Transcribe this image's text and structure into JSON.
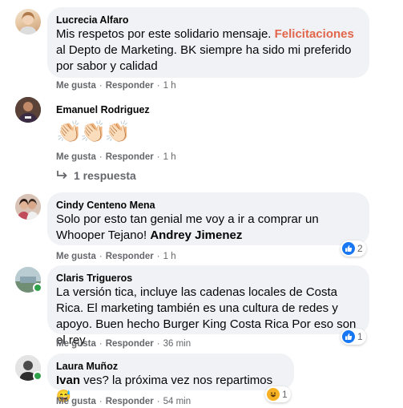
{
  "comments": [
    {
      "name": "Lucrecia Alfaro",
      "text_part1": "Mis respetos por este solidario mensaje. ",
      "highlight": "Felicitaciones",
      "text_part2": " al Depto de Marketing. BK siempre ha sido mi preferido por sabor y calidad",
      "like_label": "Me gusta",
      "reply_label": "Responder",
      "time": "1 h"
    },
    {
      "name": "Emanuel Rodriguez",
      "text": "👏🏻👏🏻👏🏻",
      "like_label": "Me gusta",
      "reply_label": "Responder",
      "time": "1 h",
      "replies_label": "1 respuesta"
    },
    {
      "name": "Cindy Centeno Mena",
      "text": "Solo por esto tan genial me voy a ir a comprar un Whooper Tejano! ",
      "tag": "Andrey Jimenez",
      "like_label": "Me gusta",
      "reply_label": "Responder",
      "time": "1 h",
      "reaction_count": "2"
    },
    {
      "name": "Claris Trigueros",
      "text": "La versión tica, incluye las cadenas locales de Costa Rica. El marketing también es una cultura de redes y apoyo. Buen hecho Burger King Costa Rica Por eso son el rey",
      "like_label": "Me gusta",
      "reply_label": "Responder",
      "time": "36 min",
      "reaction_count": "1"
    },
    {
      "name": "Laura Muñoz",
      "tag": "Ivan",
      "text": " ves? la próxima vez nos repartimos 😅",
      "like_label": "Me gusta",
      "reply_label": "Responder",
      "time": "54 min",
      "reaction_count": "1"
    }
  ],
  "colors": {
    "bubble": "#f0f2f5",
    "meta": "#65676b",
    "highlight": "#e2664b",
    "like": "#1877f2",
    "haha": "#f7b125",
    "online": "#31a24c"
  }
}
